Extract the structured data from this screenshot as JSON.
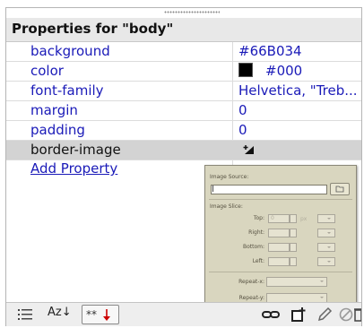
{
  "panel": {
    "title": "Properties for \"body\""
  },
  "properties": [
    {
      "name": "background",
      "value": "#66B034",
      "selected": false
    },
    {
      "name": "color",
      "value": "#000",
      "swatch": "#000000",
      "selected": false
    },
    {
      "name": "font-family",
      "value": "Helvetica, \"Treb...",
      "selected": false
    },
    {
      "name": "margin",
      "value": "0",
      "selected": false
    },
    {
      "name": "padding",
      "value": "0",
      "selected": false
    },
    {
      "name": "border-image",
      "value": "",
      "selected": true
    }
  ],
  "add_property_label": "Add Property",
  "popup": {
    "image_source_label": "Image Source:",
    "image_slice_label": "Image Slice:",
    "top_label": "Top:",
    "top_value": "0",
    "unit": "px",
    "right_label": "Right:",
    "bottom_label": "Bottom:",
    "left_label": "Left:",
    "repeat_x_label": "Repeat-x:",
    "repeat_y_label": "Repeat-y:"
  },
  "toolbar": {
    "sort_alpha_label": "Az↓",
    "show_set_label": "**↓",
    "icons": [
      "category-view-icon",
      "alpha-sort-icon",
      "show-set-icon",
      "link-icon",
      "new-rule-icon",
      "edit-icon",
      "disable-icon",
      "delete-icon"
    ]
  },
  "colors": {
    "link_blue": "#1a1ab8",
    "selected_row": "#d3d3d3",
    "popup_bg": "#d9d6bf",
    "delete_red": "#cc0000"
  }
}
